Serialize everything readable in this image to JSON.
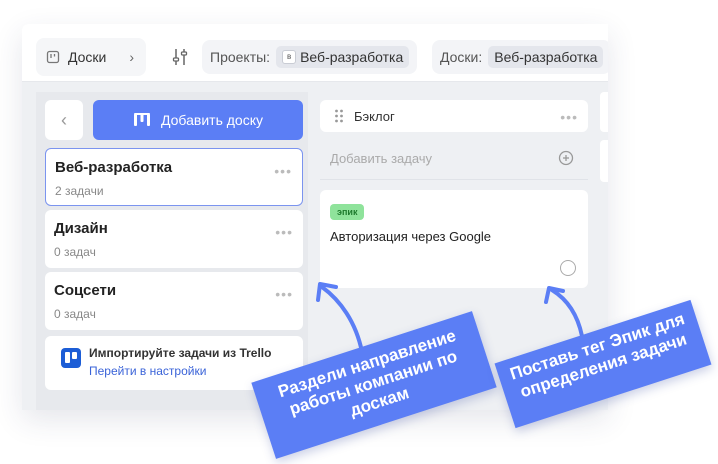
{
  "topbar": {
    "crumb": "Доски",
    "projects_label": "Проекты:",
    "projects_badge": "в",
    "projects_value": "Веб-разработка",
    "boards_label": "Доски:",
    "boards_value": "Веб-разработка"
  },
  "sidebar": {
    "add_board_label": "Добавить доску",
    "boards": [
      {
        "name": "Веб-разработка",
        "count": "2 задачи"
      },
      {
        "name": "Дизайн",
        "count": "0 задач"
      },
      {
        "name": "Соцсети",
        "count": "0 задач"
      }
    ],
    "import_title": "Импортируйте задачи из Trello",
    "import_link": "Перейти в настройки"
  },
  "column": {
    "title": "Бэклог",
    "add_task_placeholder": "Добавить задачу",
    "task": {
      "tag": "эпик",
      "title": "Авторизация через Google"
    }
  },
  "callouts": {
    "left": "Раздели направление работы компании по доскам",
    "right": "Поставь тег Эпик для определения задачи"
  },
  "colors": {
    "accent": "#5b7ef5",
    "tag_bg": "#8fe39b",
    "link": "#3a63d8"
  }
}
